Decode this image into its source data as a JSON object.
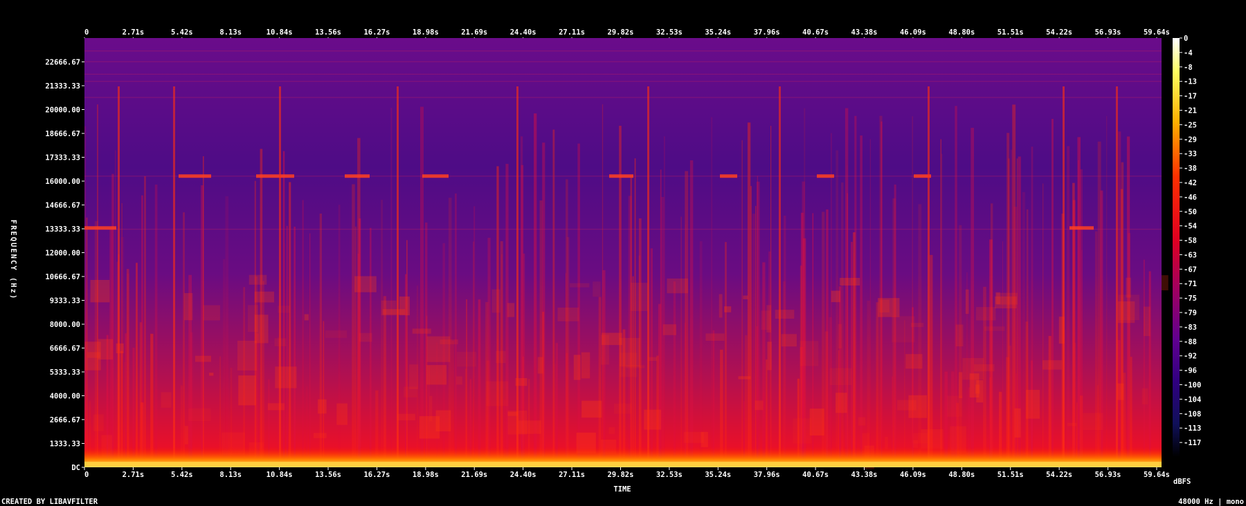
{
  "chart_data": {
    "type": "heatmap",
    "title": "",
    "xlabel": "TIME",
    "ylabel": "FREQUENCY (Hz)",
    "xlim": [
      0,
      62.35
    ],
    "ylim": [
      0,
      24000
    ],
    "x_ticks": [
      "0",
      "2.71s",
      "5.42s",
      "8.13s",
      "10.84s",
      "13.56s",
      "16.27s",
      "18.98s",
      "21.69s",
      "24.40s",
      "27.11s",
      "29.82s",
      "32.53s",
      "35.24s",
      "37.96s",
      "40.67s",
      "43.38s",
      "46.09s",
      "48.80s",
      "51.51s",
      "54.22s",
      "56.93s",
      "59.64s"
    ],
    "y_ticks": [
      "DC",
      "1333.33",
      "2666.67",
      "4000.00",
      "5333.33",
      "6666.67",
      "8000.00",
      "9333.33",
      "10666.67",
      "12000.00",
      "13333.33",
      "14666.67",
      "16000.00",
      "17333.33",
      "18666.67",
      "20000.00",
      "21333.33",
      "22666.67"
    ],
    "colorbar": {
      "unit": "dBFS",
      "ticks": [
        "0",
        "-4",
        "-8",
        "-13",
        "-17",
        "-21",
        "-25",
        "-29",
        "-33",
        "-38",
        "-42",
        "-46",
        "-50",
        "-54",
        "-58",
        "-63",
        "-67",
        "-71",
        "-75",
        "-79",
        "-83",
        "-88",
        "-92",
        "-96",
        "-100",
        "-104",
        "-108",
        "-113",
        "-117"
      ],
      "colors": [
        "#ffffff",
        "#ffff60",
        "#ffb000",
        "#ff3000",
        "#e00020",
        "#a00060",
        "#600090",
        "#300080",
        "#10105a",
        "#000000"
      ]
    },
    "footer_left": "CREATED BY LIBAVFILTER",
    "footer_right": "48000 Hz | mono",
    "grid": false
  }
}
